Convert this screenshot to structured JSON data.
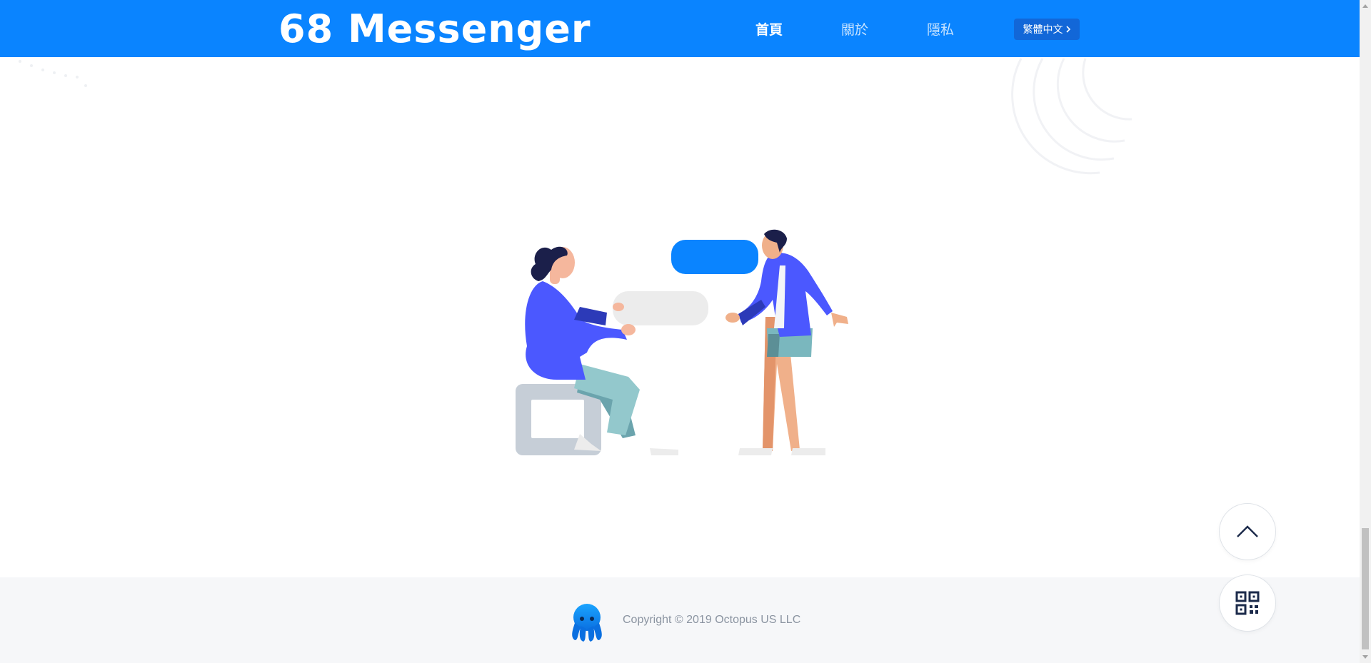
{
  "header": {
    "logo_text": "68 Messenger",
    "nav": [
      {
        "label": "首頁",
        "active": true
      },
      {
        "label": "關於",
        "active": false
      },
      {
        "label": "隱私",
        "active": false
      }
    ],
    "language_button": {
      "label": "繁體中文",
      "icon": "chevron-right-icon"
    }
  },
  "footer": {
    "logo_icon": "octopus-logo-icon",
    "copyright": "Copyright © 2019 Octopus US LLC"
  },
  "floating_buttons": [
    {
      "icon": "chevron-up-icon"
    },
    {
      "icon": "qr-code-icon"
    }
  ],
  "colors": {
    "brand_blue": "#0a84ff",
    "language_button_bg": "#1267d8",
    "footer_bg": "#f6f7f9",
    "footer_text": "#8b94a1"
  }
}
